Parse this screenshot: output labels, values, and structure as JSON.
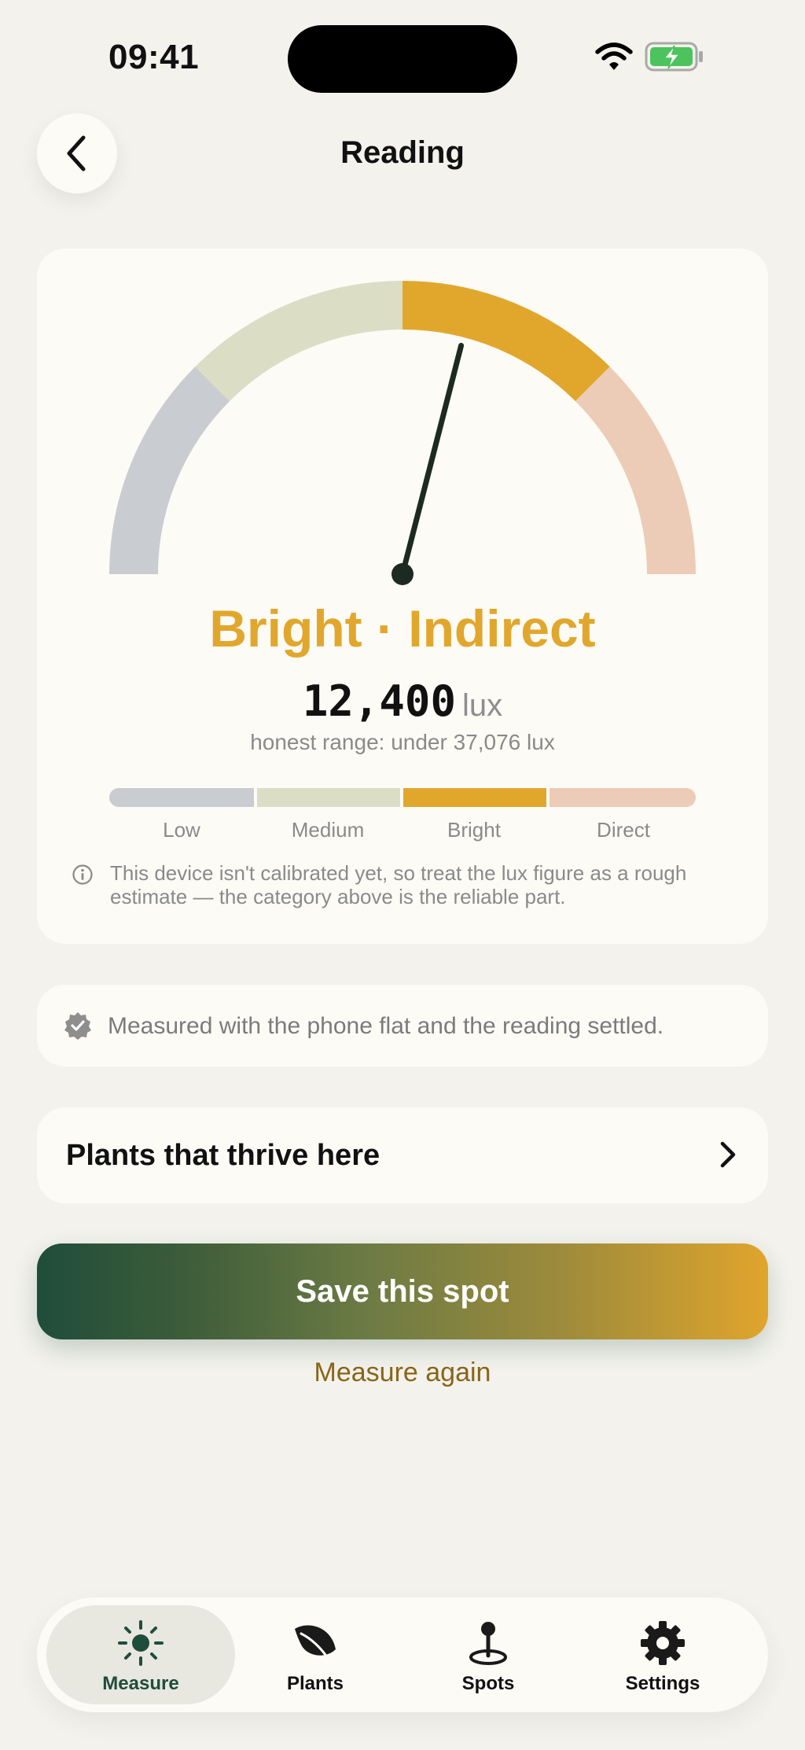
{
  "status_bar": {
    "time": "09:41"
  },
  "header": {
    "title": "Reading"
  },
  "gauge": {
    "needle_fraction": 0.58,
    "segments": [
      {
        "name": "Low",
        "color": "#c9cdd1"
      },
      {
        "name": "Medium",
        "color": "#dbdec4"
      },
      {
        "name": "Bright",
        "color": "#e1a72d"
      },
      {
        "name": "Direct",
        "color": "#ecccb7"
      }
    ]
  },
  "reading": {
    "category": "Bright · Indirect",
    "lux_value": "12,400",
    "lux_unit": "lux",
    "honest_range": "honest range: under 37,076 lux"
  },
  "scale": {
    "labels": [
      "Low",
      "Medium",
      "Bright",
      "Direct"
    ],
    "colors": [
      "#c9cdd1",
      "#dbdec4",
      "#e1a72d",
      "#ecccb7"
    ]
  },
  "calibration_note": "This device isn't calibrated yet, so treat the lux figure as a rough estimate — the category above is the reliable part.",
  "settled_note": "Measured with the phone flat and the reading settled.",
  "plants_link": {
    "label": "Plants that thrive here"
  },
  "actions": {
    "save_label": "Save this spot",
    "measure_again_label": "Measure again"
  },
  "tabs": [
    {
      "label": "Measure",
      "icon": "sun-icon",
      "active": true
    },
    {
      "label": "Plants",
      "icon": "leaf-icon",
      "active": false
    },
    {
      "label": "Spots",
      "icon": "pin-icon",
      "active": false
    },
    {
      "label": "Settings",
      "icon": "gear-icon",
      "active": false
    }
  ],
  "colors": {
    "accent": "#e1a72d",
    "brand_green": "#1f4d3b",
    "background": "#f3f2ec",
    "card": "#fcfbf6"
  }
}
